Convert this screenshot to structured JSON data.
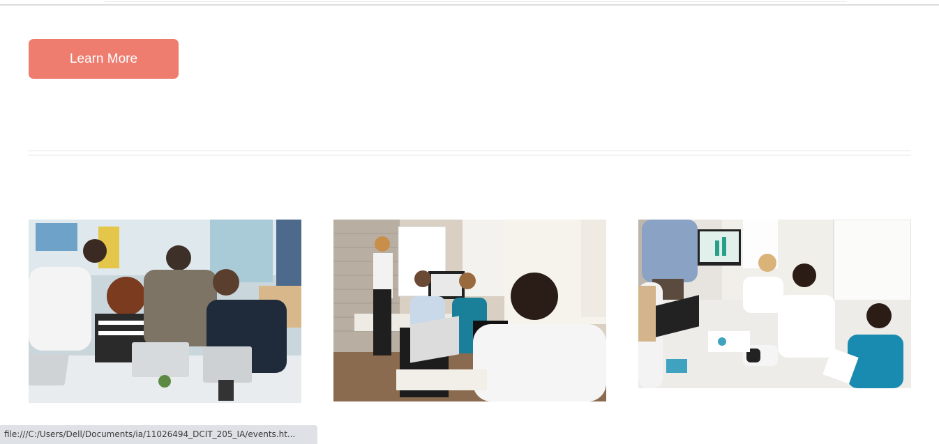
{
  "cta": {
    "label": "Learn More",
    "color": "#ee7d70"
  },
  "gallery": {
    "images": [
      {
        "alt": "team-gathered-around-laptops"
      },
      {
        "alt": "presentation-in-office"
      },
      {
        "alt": "team-meeting-at-table"
      }
    ]
  },
  "status_bar": {
    "url": "file:///C:/Users/Dell/Documents/ia/11026494_DCIT_205_IA/events.ht..."
  }
}
